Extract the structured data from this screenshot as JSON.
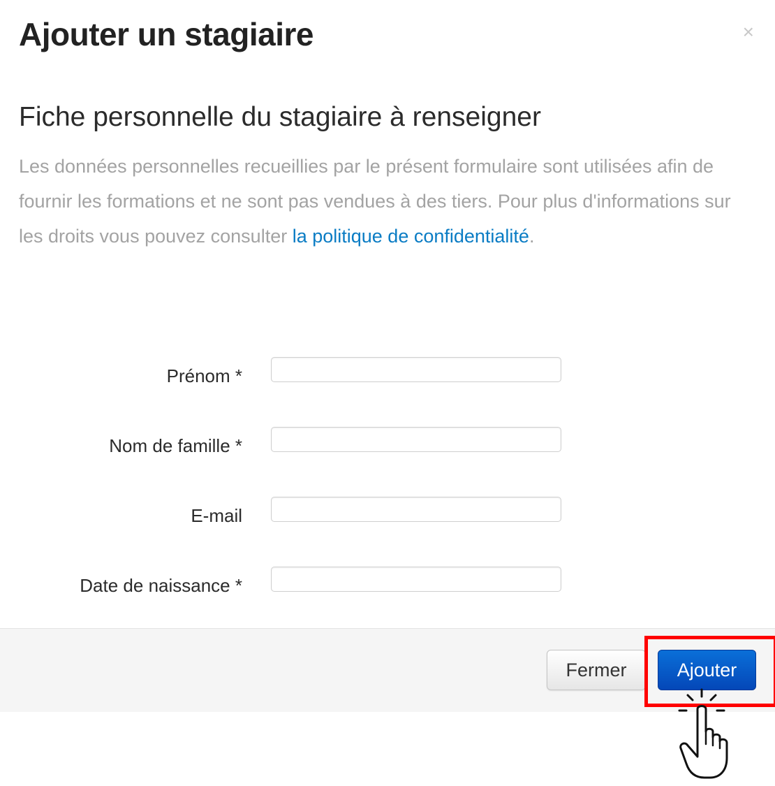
{
  "modal": {
    "title": "Ajouter un stagiaire",
    "close_symbol": "×"
  },
  "section": {
    "title": "Fiche personnelle du stagiaire à renseigner",
    "intro_text": "Les données personnelles recueillies par le présent formulaire sont utilisées afin de fournir les formations et ne sont pas vendues à des tiers. Pour plus d'informations sur les droits vous pouvez consulter ",
    "privacy_link": "la politique de confidentialité",
    "intro_end": "."
  },
  "form": {
    "fields": [
      {
        "label": "Prénom *",
        "value": ""
      },
      {
        "label": "Nom de famille *",
        "value": ""
      },
      {
        "label": "E-mail",
        "value": ""
      },
      {
        "label": "Date de naissance *",
        "value": ""
      }
    ]
  },
  "footer": {
    "close_label": "Fermer",
    "add_label": "Ajouter"
  },
  "colors": {
    "primary_button": "#0a5fd0",
    "link": "#0a7cc4",
    "highlight": "#ff0000"
  },
  "icons": {
    "close": "close-icon",
    "cursor": "hand-pointer-icon"
  }
}
